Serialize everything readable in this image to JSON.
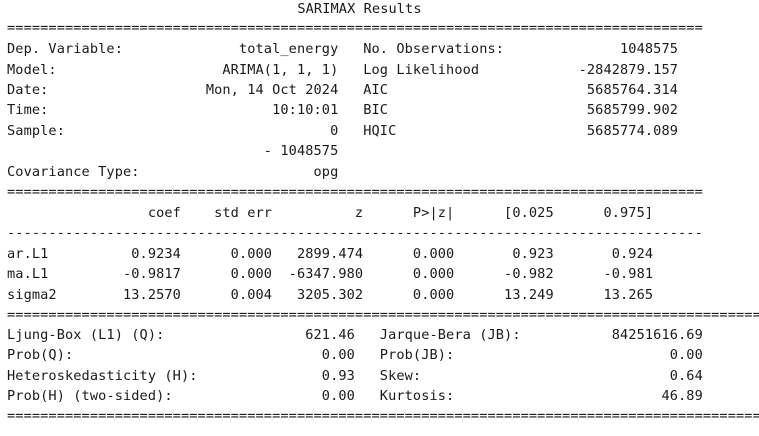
{
  "title": "SARIMAX Results",
  "separator_double": "====================================================================================",
  "separator_single": "------------------------------------------------------------------------------------",
  "separator_wide": "===========================================================================================",
  "header_rows": [
    "Dep. Variable:              total_energy   No. Observations:              1048575",
    "Model:                    ARIMA(1, 1, 1)   Log Likelihood            -2842879.157",
    "Date:                   Mon, 14 Oct 2024   AIC                        5685764.314",
    "Time:                           10:10:01   BIC                        5685799.902",
    "Sample:                                0   HQIC                       5685774.089",
    "                               - 1048575",
    "Covariance Type:                     opg"
  ],
  "coef_header": "                 coef    std err          z      P>|z|      [0.025      0.975]",
  "coef_rows": [
    "ar.L1          0.9234      0.000   2899.474      0.000       0.923       0.924",
    "ma.L1         -0.9817      0.000  -6347.980      0.000      -0.982      -0.981",
    "sigma2        13.2570      0.004   3205.302      0.000      13.249      13.265"
  ],
  "diag_rows": [
    "Ljung-Box (L1) (Q):                 621.46   Jarque-Bera (JB):           84251616.69",
    "Prob(Q):                              0.00   Prob(JB):                          0.00",
    "Heteroskedasticity (H):               0.93   Skew:                              0.64",
    "Prob(H) (two-sided):                  0.00   Kurtosis:                         46.89"
  ]
}
